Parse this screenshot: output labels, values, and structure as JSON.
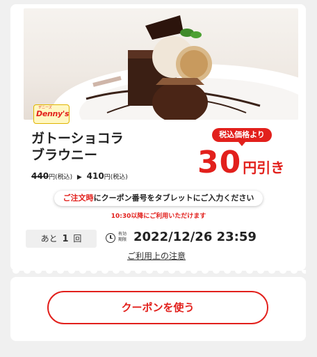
{
  "coupon": {
    "tag": "税込価格より",
    "title_line1": "ガトーショコラ",
    "title_line2": "ブラウニー",
    "old_price": "440",
    "old_price_unit": "円(税込)",
    "new_price": "410",
    "new_price_unit": "円(税込)",
    "discount_value": "30",
    "discount_unit": "円引き",
    "notice_red": "ご注文時",
    "notice_rest": "にクーポン番号をタブレットにご入力ください",
    "hours_note": "10:30以降にご利用いただけます",
    "remaining_prefix": "あと",
    "remaining_count": "1",
    "remaining_suffix": "回",
    "expire_label": "有効期限",
    "expire_date": "2022/12/26 23:59",
    "terms_link": "ご利用上の注意"
  },
  "brand": {
    "logo_text": "Denny's",
    "logo_sub": "デニーズ",
    "accent_color": "#e2201c"
  },
  "action": {
    "use_button": "クーポンを使う"
  }
}
